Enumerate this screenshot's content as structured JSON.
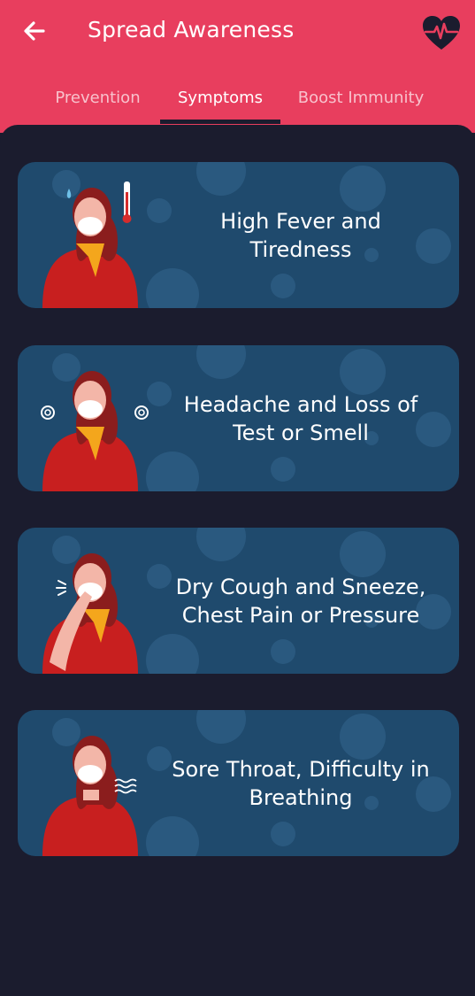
{
  "header": {
    "title": "Spread Awareness",
    "back_icon": "arrow-left-icon",
    "heart_icon": "heartbeat-icon",
    "background_color": "#e83e5e"
  },
  "tabs": [
    {
      "label": "Prevention",
      "active": false
    },
    {
      "label": "Symptoms",
      "active": true
    },
    {
      "label": "Boost Immunity",
      "active": false
    }
  ],
  "cards": [
    {
      "text": "High Fever and Tiredness",
      "illustration": "woman-fever-thermometer"
    },
    {
      "text": "Headache and Loss of Test or Smell",
      "illustration": "woman-headache-dizzy"
    },
    {
      "text": "Dry Cough and Sneeze, Chest Pain or Pressure",
      "illustration": "woman-coughing"
    },
    {
      "text": "Sore Throat, Difficulty in Breathing",
      "illustration": "woman-breathing-difficulty"
    }
  ],
  "colors": {
    "background": "#1b1c2e",
    "card": "#1f4a6d",
    "accent": "#e83e5e"
  }
}
